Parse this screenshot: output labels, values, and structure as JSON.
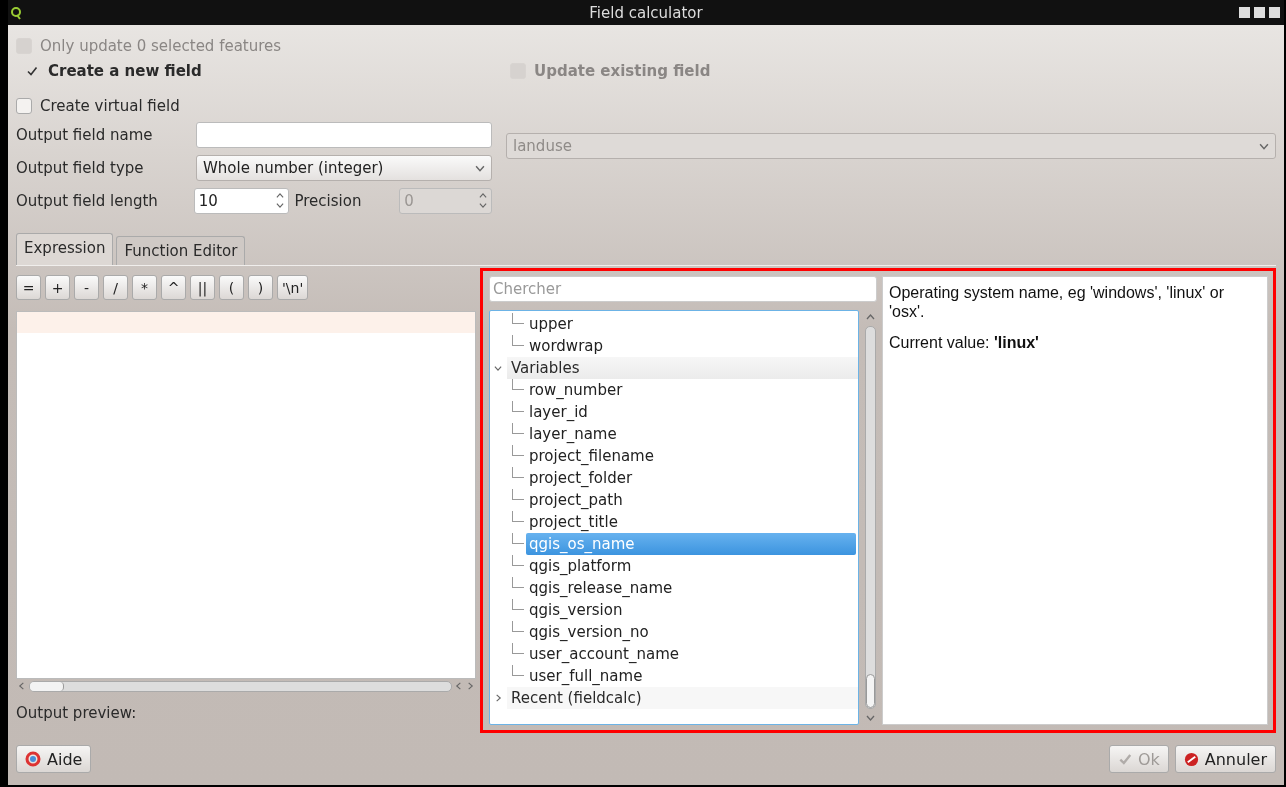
{
  "window": {
    "title": "Field calculator"
  },
  "options": [
    {
      "label": "Only update 0 selected features",
      "checked": false,
      "disabled": true
    }
  ],
  "modes": [
    {
      "label": "Create a new field",
      "checked": true,
      "disabled": false
    },
    {
      "label": "Update existing field",
      "checked": false,
      "disabled": true
    }
  ],
  "virtual_field": {
    "label": "Create virtual field",
    "checked": false
  },
  "form": {
    "name_label": "Output field name",
    "type_label": "Output field type",
    "type_value": "Whole number (integer)",
    "length_label": "Output field length",
    "length_value": "10",
    "precision_label": "Precision",
    "precision_value": "0",
    "precision_disabled": true
  },
  "existing_field": {
    "value": "landuse",
    "disabled": true
  },
  "tabs": [
    {
      "label": "Expression",
      "selected": true
    },
    {
      "label": "Function Editor",
      "selected": false
    }
  ],
  "operators": [
    "=",
    "+",
    "-",
    "/",
    "*",
    "^",
    "||",
    "(",
    ")",
    "'\\n'"
  ],
  "output_preview": {
    "label": "Output preview:"
  },
  "search": {
    "placeholder": "Chercher"
  },
  "tree": {
    "continued_children": [
      {
        "label": "upper",
        "selected": false
      },
      {
        "label": "wordwrap",
        "selected": false
      }
    ],
    "groups": [
      {
        "label": "Variables",
        "expanded": true,
        "children": [
          {
            "label": "row_number",
            "selected": false
          },
          {
            "label": "layer_id",
            "selected": false
          },
          {
            "label": "layer_name",
            "selected": false
          },
          {
            "label": "project_filename",
            "selected": false
          },
          {
            "label": "project_folder",
            "selected": false
          },
          {
            "label": "project_path",
            "selected": false
          },
          {
            "label": "project_title",
            "selected": false
          },
          {
            "label": "qgis_os_name",
            "selected": true
          },
          {
            "label": "qgis_platform",
            "selected": false
          },
          {
            "label": "qgis_release_name",
            "selected": false
          },
          {
            "label": "qgis_version",
            "selected": false
          },
          {
            "label": "qgis_version_no",
            "selected": false
          },
          {
            "label": "user_account_name",
            "selected": false
          },
          {
            "label": "user_full_name",
            "selected": false
          }
        ]
      },
      {
        "label": "Recent (fieldcalc)",
        "expanded": false
      }
    ]
  },
  "help": {
    "description": "Operating system name, eg 'windows', 'linux' or 'osx'.",
    "current_value": "Current value: **'linux'**"
  },
  "buttons": {
    "help": "Aide",
    "ok": "Ok",
    "ok_disabled": true,
    "cancel": "Annuler"
  }
}
